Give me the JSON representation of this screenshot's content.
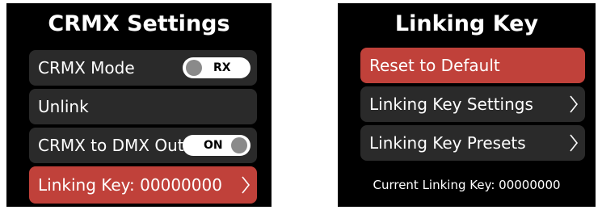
{
  "left_screen": {
    "title": "CRMX Settings",
    "rows": [
      {
        "label": "CRMX Mode",
        "toggle_text": "RX",
        "toggle_state": "RX"
      },
      {
        "label": "Unlink"
      },
      {
        "label": "CRMX to DMX Out",
        "toggle_text": "ON",
        "toggle_state": "ON"
      },
      {
        "label": "Linking Key: 00000000",
        "selected": true
      }
    ]
  },
  "right_screen": {
    "title": "Linking Key",
    "rows": [
      {
        "label": "Reset to Default",
        "selected": true
      },
      {
        "label": "Linking Key Settings"
      },
      {
        "label": "Linking Key Presets"
      }
    ],
    "footer": "Current Linking Key: 00000000"
  },
  "colors": {
    "screen_bg": "#000000",
    "row_bg": "#2a2a2a",
    "selected_bg": "#c0413a",
    "toggle_bg": "#ffffff",
    "toggle_knob": "#8a8a8a"
  },
  "icons": {
    "chevron": "chevron-right-icon"
  }
}
